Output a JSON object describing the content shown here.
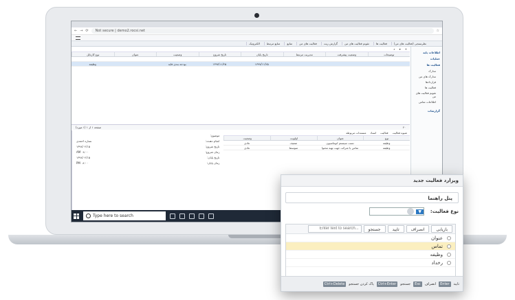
{
  "browser": {
    "security": "Not secure",
    "url": "demo2.rocsi.net"
  },
  "app": {
    "tabs": [
      "نظرسنجی (فعالیت های من)",
      "فعالیت ها",
      "تقویم فعالیت های من",
      "گزارش ریت",
      "فعالیت های من",
      "منابع",
      "منابع مرتبط",
      "الکترونیک"
    ],
    "grid_headers": [
      "توضیحات",
      "وضعیت پیشرفت",
      "مدیریت مرتبط",
      "تاریخ پایان",
      "تاریخ شروع",
      "وضعیت",
      "عنوان",
      "نوع کارتابل"
    ],
    "grid_row": [
      "",
      "",
      "",
      "۱۳۹۷/۱۱/۲۵",
      "۱۳۹۷/۱۱/۲۵",
      "بودجه بندی فایه",
      "",
      "وظیفه"
    ],
    "pager_text": "صفحه ۱ از ۱ (۱ مورد)",
    "pager_size": "۲۰",
    "lower_tabs": [
      "شیوه فعالیت",
      "فعالیت",
      "اسناد",
      "مستندات مربوطه"
    ],
    "detail_fields": [
      {
        "label": "موضوع:",
        "value": ""
      },
      {
        "label": "انجام دهنده:",
        "value": "نساره احمدی"
      },
      {
        "label": "تاریخ شروع:",
        "value": "۱۳۹۸/۰۲/۱۵"
      },
      {
        "label": "زمان شروع:",
        "value": "۰۸:۰۰ AM"
      },
      {
        "label": "تاریخ پایان:",
        "value": "۱۳۹۸/۰۲/۱۵"
      },
      {
        "label": "زمان پایان:",
        "value": "۰۸:۰۰ PM"
      }
    ],
    "sub_rows": [
      {
        "type": "وظیفه",
        "title": "تست سیستم اتوماسیون",
        "priority": "ضعیف",
        "status": "عادی"
      },
      {
        "type": "وظیفه",
        "title": "تماس با شرکت جهت تهیه محتوا",
        "priority": "متوسط",
        "status": "عادی"
      }
    ]
  },
  "sidebar": {
    "section1": "اطلاعات پایه",
    "section2": "عملیات",
    "section3": "فعالیت ها",
    "items": [
      "مدارک",
      "مدارک های من",
      "قراردادها",
      "فعالیت ها",
      "تقویم فعالیت های من",
      "اطلاعات تماس"
    ],
    "section4": "گزارشات"
  },
  "taskbar": {
    "search_placeholder": "Type here to search"
  },
  "popup": {
    "title": "ویزارد فعالیت جدید",
    "guide_label": "پنل راهنما",
    "type_label": "نوع فعالیت:",
    "buttons": [
      "جستجو",
      "تایید",
      "انصراف",
      "بازیابی"
    ],
    "search_placeholder": "Enter text to search...",
    "options": [
      "عنوان",
      "تماس",
      "وظیفه",
      "رخداد"
    ],
    "highlighted_index": 1,
    "footer": [
      {
        "key": "Enter",
        "label": "تایید"
      },
      {
        "key": "Esc",
        "label": "انصراف"
      },
      {
        "key": "Ctrl+Enter",
        "label": "جستجو"
      },
      {
        "key": "Ctrl+Delete",
        "label": "پاک کردن جستجو"
      }
    ]
  }
}
